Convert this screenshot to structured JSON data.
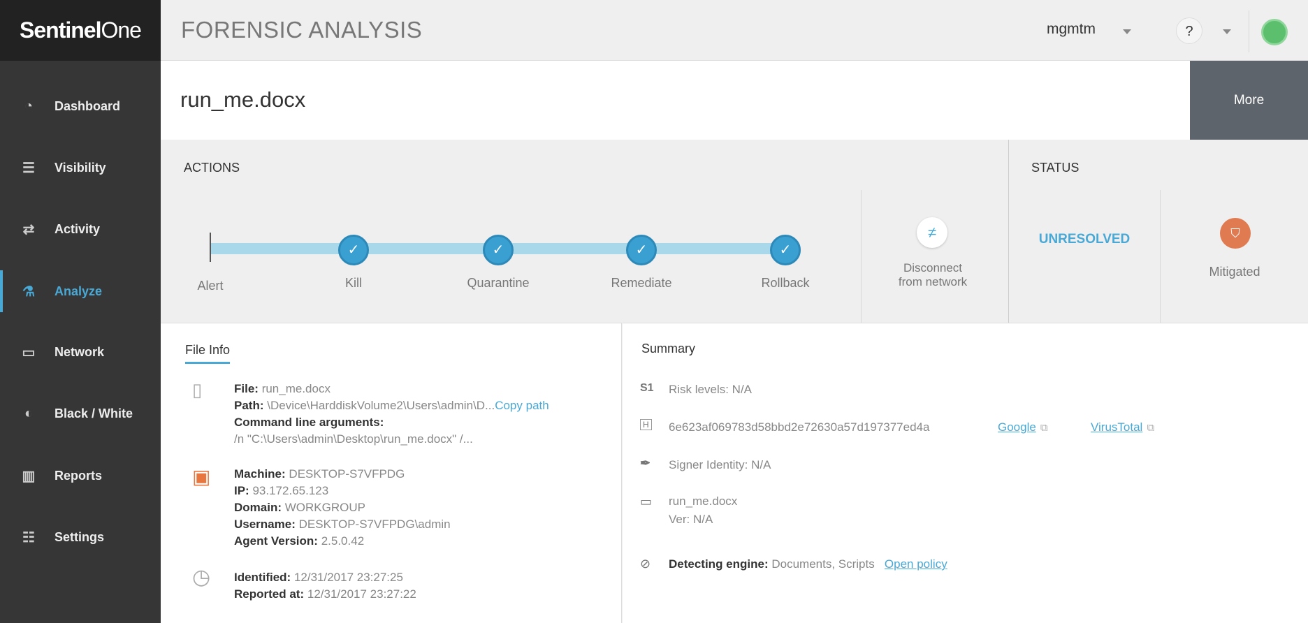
{
  "brand": {
    "bold": "Sentinel",
    "light": "One"
  },
  "header": {
    "title": "FORENSIC ANALYSIS",
    "user": "mgmtm",
    "help": "?"
  },
  "sidebar": {
    "items": [
      {
        "label": "Dashboard",
        "icon": "gauge-icon",
        "glyph": "◔"
      },
      {
        "label": "Visibility",
        "icon": "search-list-icon",
        "glyph": "☰"
      },
      {
        "label": "Activity",
        "icon": "activity-icon",
        "glyph": "⇄"
      },
      {
        "label": "Analyze",
        "icon": "flask-icon",
        "glyph": "⚗"
      },
      {
        "label": "Network",
        "icon": "network-icon",
        "glyph": "▭"
      },
      {
        "label": "Black / White",
        "icon": "blackwhite-icon",
        "glyph": "◐"
      },
      {
        "label": "Reports",
        "icon": "reports-icon",
        "glyph": "▥"
      },
      {
        "label": "Settings",
        "icon": "settings-icon",
        "glyph": "☷"
      }
    ],
    "active": "Analyze"
  },
  "file_title": "run_me.docx",
  "more_label": "More",
  "actions": {
    "title": "ACTIONS",
    "steps": [
      "Alert",
      "Kill",
      "Quarantine",
      "Remediate",
      "Rollback"
    ],
    "disconnect": [
      "Disconnect",
      "from network"
    ]
  },
  "status": {
    "title": "STATUS",
    "state": "UNRESOLVED",
    "mitigation": "Mitigated"
  },
  "file_info": {
    "tab": "File Info",
    "file_label": "File:",
    "file": "run_me.docx",
    "path_label": "Path:",
    "path": "\\Device\\HarddiskVolume2\\Users\\admin\\D...",
    "copy_path": "Copy path",
    "cmd_label": "Command line arguments:",
    "cmd": "/n \"C:\\Users\\admin\\Desktop\\run_me.docx\" /...",
    "machine_label": "Machine:",
    "machine": "DESKTOP-S7VFPDG",
    "ip_label": "IP:",
    "ip": "93.172.65.123",
    "domain_label": "Domain:",
    "domain": "WORKGROUP",
    "username_label": "Username:",
    "username": "DESKTOP-S7VFPDG\\admin",
    "agent_label": "Agent Version:",
    "agent": "2.5.0.42",
    "identified_label": "Identified:",
    "identified": "12/31/2017 23:27:25",
    "reported_label": "Reported at:",
    "reported": "12/31/2017 23:27:22"
  },
  "summary": {
    "title": "Summary",
    "s1": "S1",
    "risk": "Risk levels: N/A",
    "hash_icon": "H",
    "hash": "6e623af069783d58bbd2e72630a57d197377ed4a",
    "google": "Google",
    "virustotal": "VirusTotal",
    "signer": "Signer Identity: N/A",
    "name": "run_me.docx",
    "ver": "Ver: N/A",
    "engine_label": "Detecting engine:",
    "engine": "Documents, Scripts",
    "open_policy": "Open policy"
  },
  "colors": {
    "accent": "#49a9d6",
    "step": "#3a9fd1",
    "more": "#5e646b",
    "mitigated": "#e07a50",
    "avatar": "#5cbf6e"
  }
}
